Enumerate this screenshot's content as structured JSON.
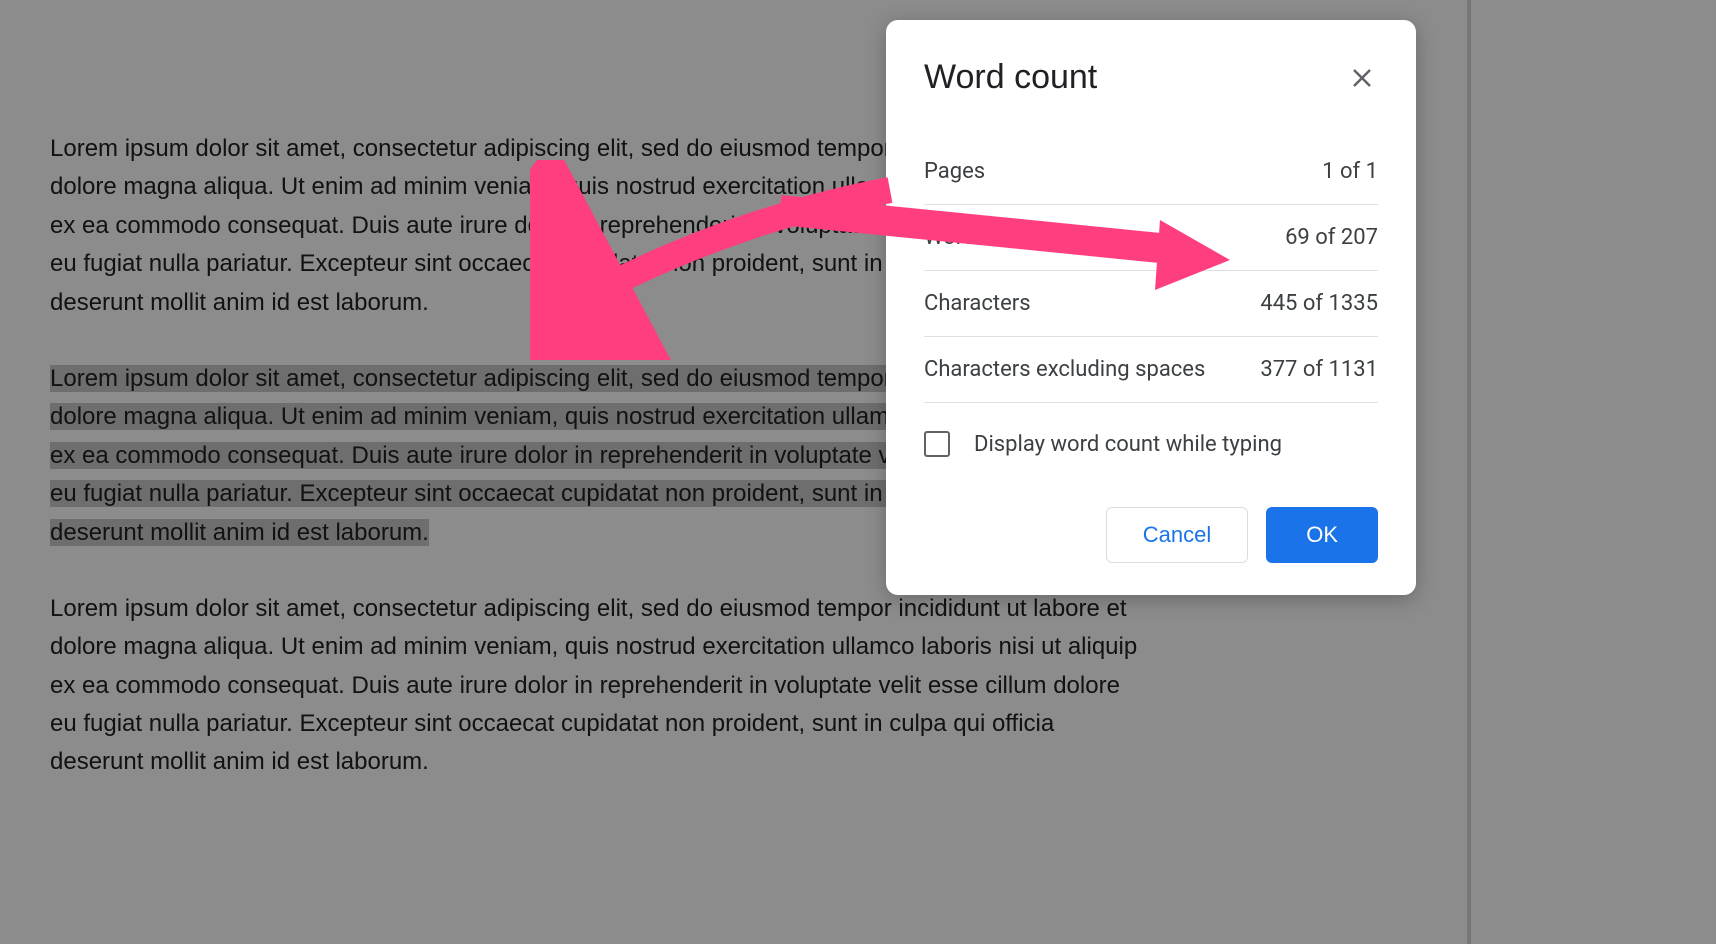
{
  "document": {
    "paragraph1": "Lorem ipsum dolor sit amet, consectetur adipiscing elit, sed do eiusmod tempor incididunt ut labore et dolore magna aliqua. Ut enim ad minim veniam, quis nostrud exercitation ullamco laboris nisi ut aliquip ex ea commodo consequat. Duis aute irure dolor in reprehenderit in voluptate velit esse cillum dolore eu fugiat nulla pariatur. Excepteur sint occaecat cupidatat non proident, sunt in culpa qui officia deserunt mollit anim id est laborum.",
    "paragraph2": "Lorem ipsum dolor sit amet, consectetur adipiscing elit, sed do eiusmod tempor incididunt ut labore et dolore magna aliqua. Ut enim ad minim veniam, quis nostrud exercitation ullamco laboris nisi ut aliquip ex ea commodo consequat. Duis aute irure dolor in reprehenderit in voluptate velit esse cillum dolore eu fugiat nulla pariatur. Excepteur sint occaecat cupidatat non proident, sunt in culpa qui officia deserunt mollit anim id est laborum.",
    "paragraph3": "Lorem ipsum dolor sit amet, consectetur adipiscing elit, sed do eiusmod tempor incididunt ut labore et dolore magna aliqua. Ut enim ad minim veniam, quis nostrud exercitation ullamco laboris nisi ut aliquip ex ea commodo consequat. Duis aute irure dolor in reprehenderit in voluptate velit esse cillum dolore eu fugiat nulla pariatur. Excepteur sint occaecat cupidatat non proident, sunt in culpa qui officia deserunt mollit anim id est laborum."
  },
  "dialog": {
    "title": "Word count",
    "stats": {
      "pages_label": "Pages",
      "pages_value": "1 of 1",
      "words_label": "Words",
      "words_value": "69 of 207",
      "characters_label": "Characters",
      "characters_value": "445 of 1335",
      "chars_no_spaces_label": "Characters excluding spaces",
      "chars_no_spaces_value": "377 of 1131"
    },
    "checkbox_label": "Display word count while typing",
    "cancel_label": "Cancel",
    "ok_label": "OK"
  },
  "annotation": {
    "color": "#ff3e7f"
  }
}
